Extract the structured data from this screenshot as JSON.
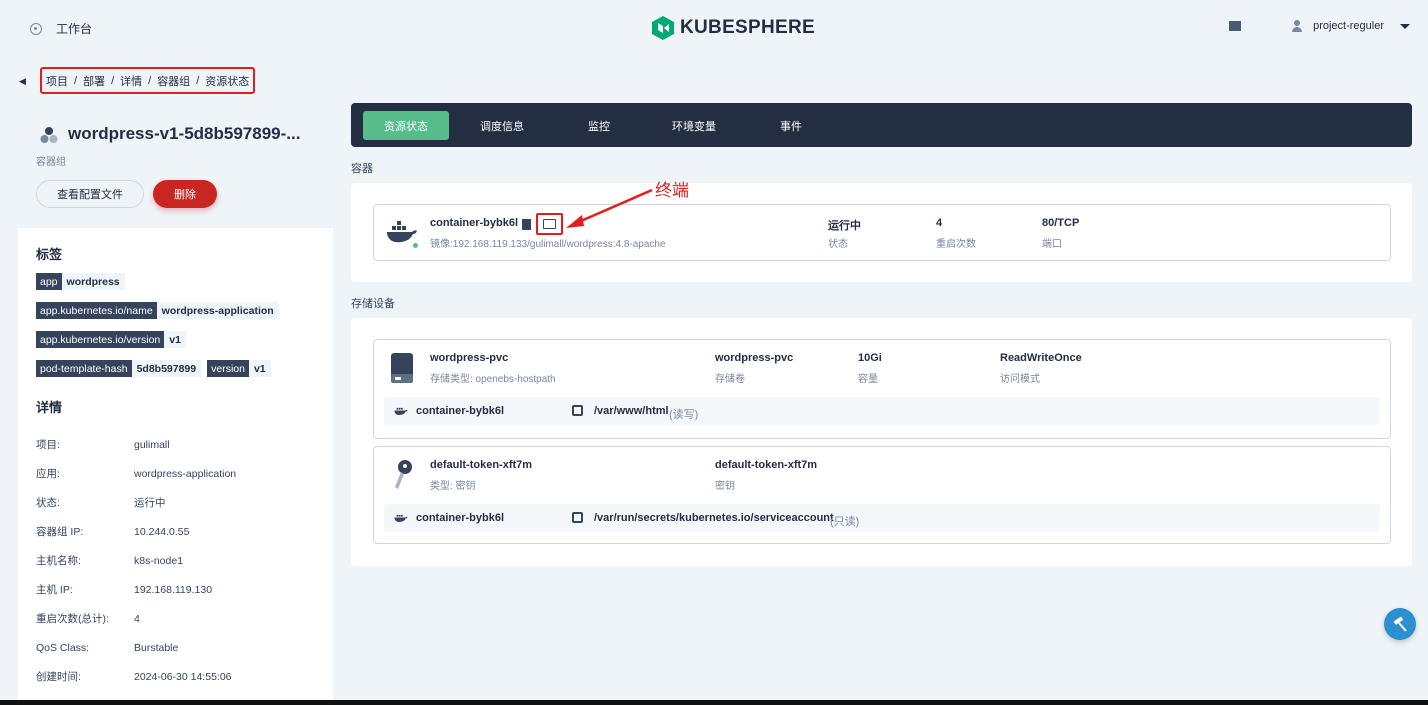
{
  "header": {
    "workbench": "工作台",
    "brand": "KUBESPHERE",
    "user": "project-reguler"
  },
  "breadcrumb": [
    "项目",
    "部署",
    "详情",
    "容器组",
    "资源状态"
  ],
  "pod": {
    "title": "wordpress-v1-5d8b597899-...",
    "subtitle": "容器组",
    "view_config": "查看配置文件",
    "delete": "删除"
  },
  "labels": {
    "title": "标签",
    "items": [
      {
        "k": "app",
        "v": "wordpress"
      },
      {
        "k": "app.kubernetes.io/name",
        "v": "wordpress-application"
      },
      {
        "k": "app.kubernetes.io/version",
        "v": "v1"
      },
      {
        "k": "pod-template-hash",
        "v": "5d8b597899"
      },
      {
        "k": "version",
        "v": "v1"
      }
    ]
  },
  "details": {
    "title": "详情",
    "rows": [
      {
        "k": "项目:",
        "v": "gulimall"
      },
      {
        "k": "应用:",
        "v": "wordpress-application"
      },
      {
        "k": "状态:",
        "v": "运行中"
      },
      {
        "k": "容器组 IP:",
        "v": "10.244.0.55"
      },
      {
        "k": "主机名称:",
        "v": "k8s-node1"
      },
      {
        "k": "主机 IP:",
        "v": "192.168.119.130"
      },
      {
        "k": "重启次数(总计):",
        "v": "4"
      },
      {
        "k": "QoS Class:",
        "v": "Burstable"
      },
      {
        "k": "创建时间:",
        "v": "2024-06-30 14:55:06"
      }
    ]
  },
  "tabs": [
    "资源状态",
    "调度信息",
    "监控",
    "环境变量",
    "事件"
  ],
  "containers_label": "容器",
  "container": {
    "name": "container-bybk6l",
    "image": "镜像:192.168.119.133/gulimall/wordpress:4.8-apache",
    "status": "运行中",
    "status_label": "状态",
    "restarts": "4",
    "restarts_label": "重启次数",
    "port": "80/TCP",
    "port_label": "端口"
  },
  "annotation": "终端",
  "storage_label": "存储设备",
  "volumes": [
    {
      "name": "wordpress-pvc",
      "type": "存储类型: openebs-hostpath",
      "vol": "wordpress-pvc",
      "vol_label": "存储卷",
      "cap": "10Gi",
      "cap_label": "容量",
      "mode": "ReadWriteOnce",
      "mode_label": "访问模式",
      "mount_container": "container-bybk6l",
      "mount_path": "/var/www/html",
      "mount_mode": "(读写)"
    },
    {
      "name": "default-token-xft7m",
      "type": "类型: 密钥",
      "vol": "default-token-xft7m",
      "vol_label": "密钥",
      "mount_container": "container-bybk6l",
      "mount_path": "/var/run/secrets/kubernetes.io/serviceaccount",
      "mount_mode": "(只读)"
    }
  ],
  "colors": {
    "accent": "#55bc8a",
    "danger": "#ca2621",
    "dark": "#242e42"
  }
}
